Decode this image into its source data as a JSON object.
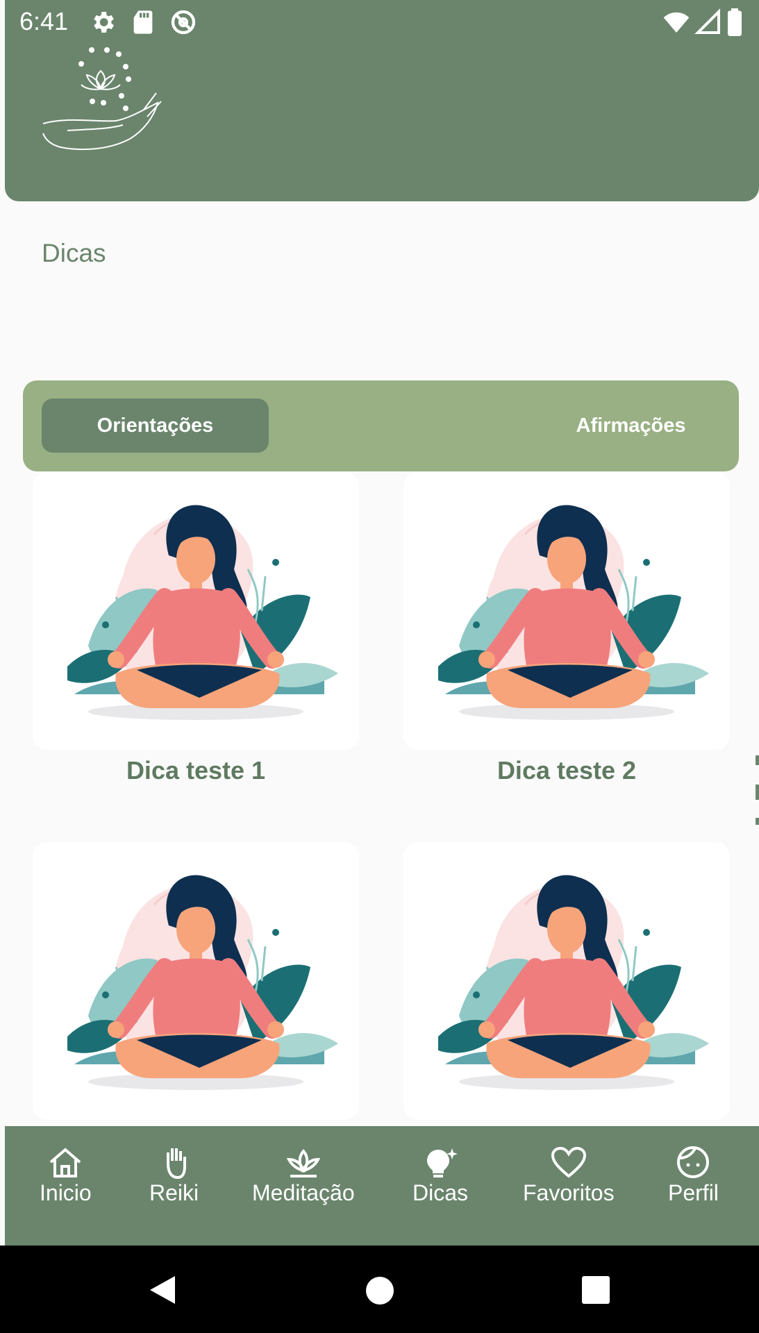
{
  "status_bar": {
    "time": "6:41",
    "left_icons": [
      "gear-icon",
      "sd-card-icon",
      "no-location-icon"
    ],
    "right_icons": [
      "wifi-icon",
      "signal-icon",
      "battery-icon"
    ]
  },
  "header": {
    "logo_icon": "hand-lotus-logo",
    "color": "#6a856c"
  },
  "page": {
    "title": "Dicas"
  },
  "tabs": [
    {
      "label": "Orientações",
      "active": true
    },
    {
      "label": "Afirmações",
      "active": false
    }
  ],
  "cards": [
    {
      "title": "Dica teste 1",
      "image_icon": "meditation-illustration"
    },
    {
      "title": "Dica teste 2",
      "image_icon": "meditation-illustration"
    },
    {
      "title": "",
      "image_icon": "meditation-illustration"
    },
    {
      "title": "",
      "image_icon": "meditation-illustration"
    }
  ],
  "bottom_nav": {
    "items": [
      {
        "label": "Inicio",
        "icon": "home-icon"
      },
      {
        "label": "Reiki",
        "icon": "hand-icon"
      },
      {
        "label": "Meditação",
        "icon": "lotus-icon"
      },
      {
        "label": "Dicas",
        "icon": "lightbulb-icon"
      },
      {
        "label": "Favoritos",
        "icon": "heart-icon"
      },
      {
        "label": "Perfil",
        "icon": "face-icon"
      }
    ]
  },
  "system_nav": [
    "back-button",
    "home-button",
    "recents-button"
  ],
  "colors": {
    "primary": "#6a856c",
    "tab_bar": "#98b083",
    "background": "#fafafa",
    "card": "#ffffff",
    "text_green": "#5f7a60"
  }
}
